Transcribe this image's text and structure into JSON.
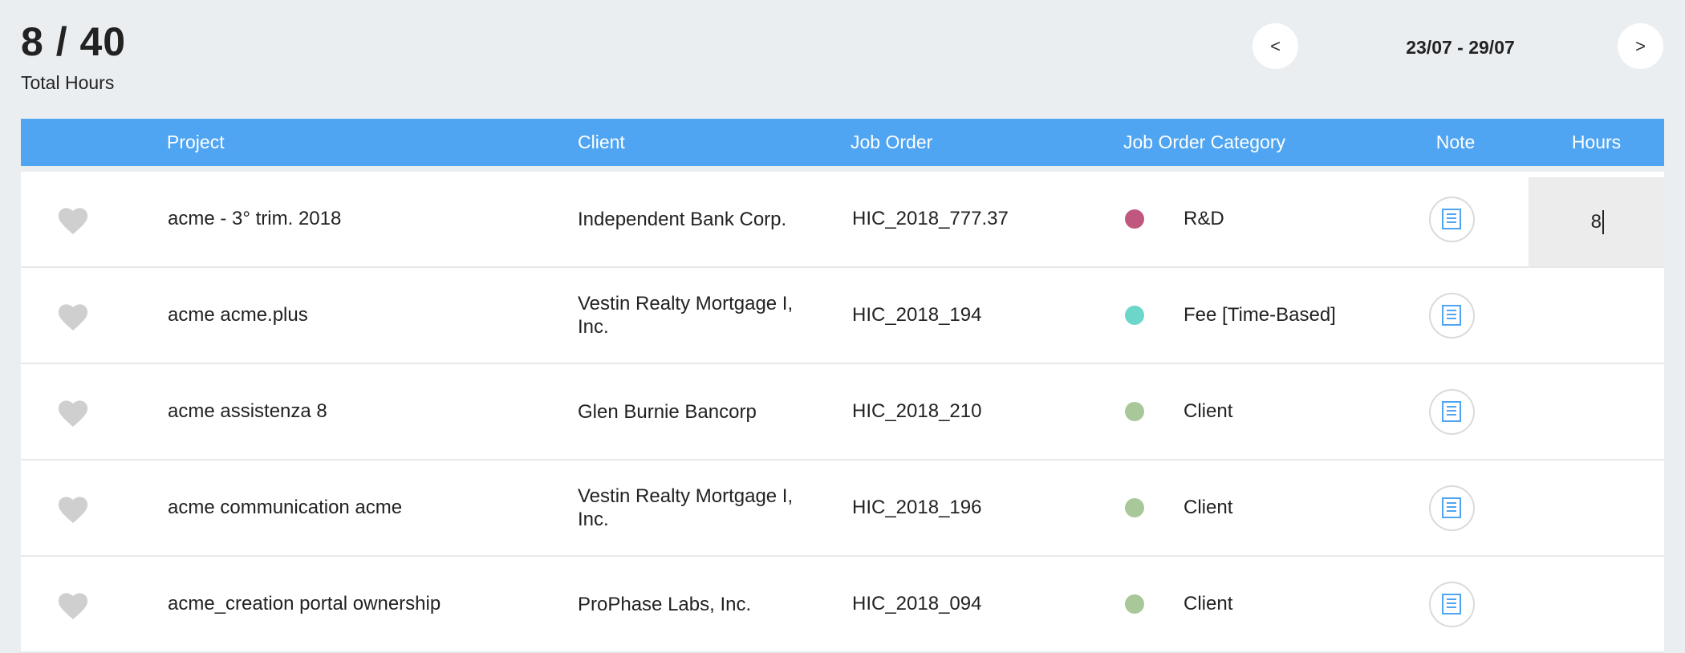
{
  "summary": {
    "value": "8 / 40",
    "label": "Total Hours"
  },
  "week_nav": {
    "prev_label": "<",
    "range": "23/07 - 29/07",
    "next_label": ">"
  },
  "table": {
    "headers": {
      "project": "Project",
      "client": "Client",
      "job_order": "Job Order",
      "category": "Job Order Category",
      "note": "Note",
      "hours": "Hours"
    },
    "rows": [
      {
        "project": "acme - 3° trim. 2018",
        "client": "Independent Bank Corp.",
        "job_order": "HIC_2018_777.37",
        "category": "R&D",
        "category_color": "#c0577f",
        "hours": "8"
      },
      {
        "project": "acme acme.plus",
        "client_line1": "Vestin Realty Mortgage I,",
        "client_line2": "Inc.",
        "job_order": "HIC_2018_194",
        "category": "Fee [Time-Based]",
        "category_color": "#6dd6cb",
        "hours": ""
      },
      {
        "project": "acme assistenza 8",
        "client": "Glen Burnie Bancorp",
        "job_order": "HIC_2018_210",
        "category": "Client",
        "category_color": "#a8c89a",
        "hours": ""
      },
      {
        "project": "acme communication acme",
        "client_line1": "Vestin Realty Mortgage I,",
        "client_line2": "Inc.",
        "job_order": "HIC_2018_196",
        "category": "Client",
        "category_color": "#a8c89a",
        "hours": ""
      },
      {
        "project": "acme_creation portal ownership",
        "client": "ProPhase Labs, Inc.",
        "job_order": "HIC_2018_094",
        "category": "Client",
        "category_color": "#a8c89a",
        "hours": ""
      }
    ]
  },
  "icons": {
    "favorite": "heart-icon",
    "note": "note-icon",
    "accent": "#4fa5f2"
  }
}
